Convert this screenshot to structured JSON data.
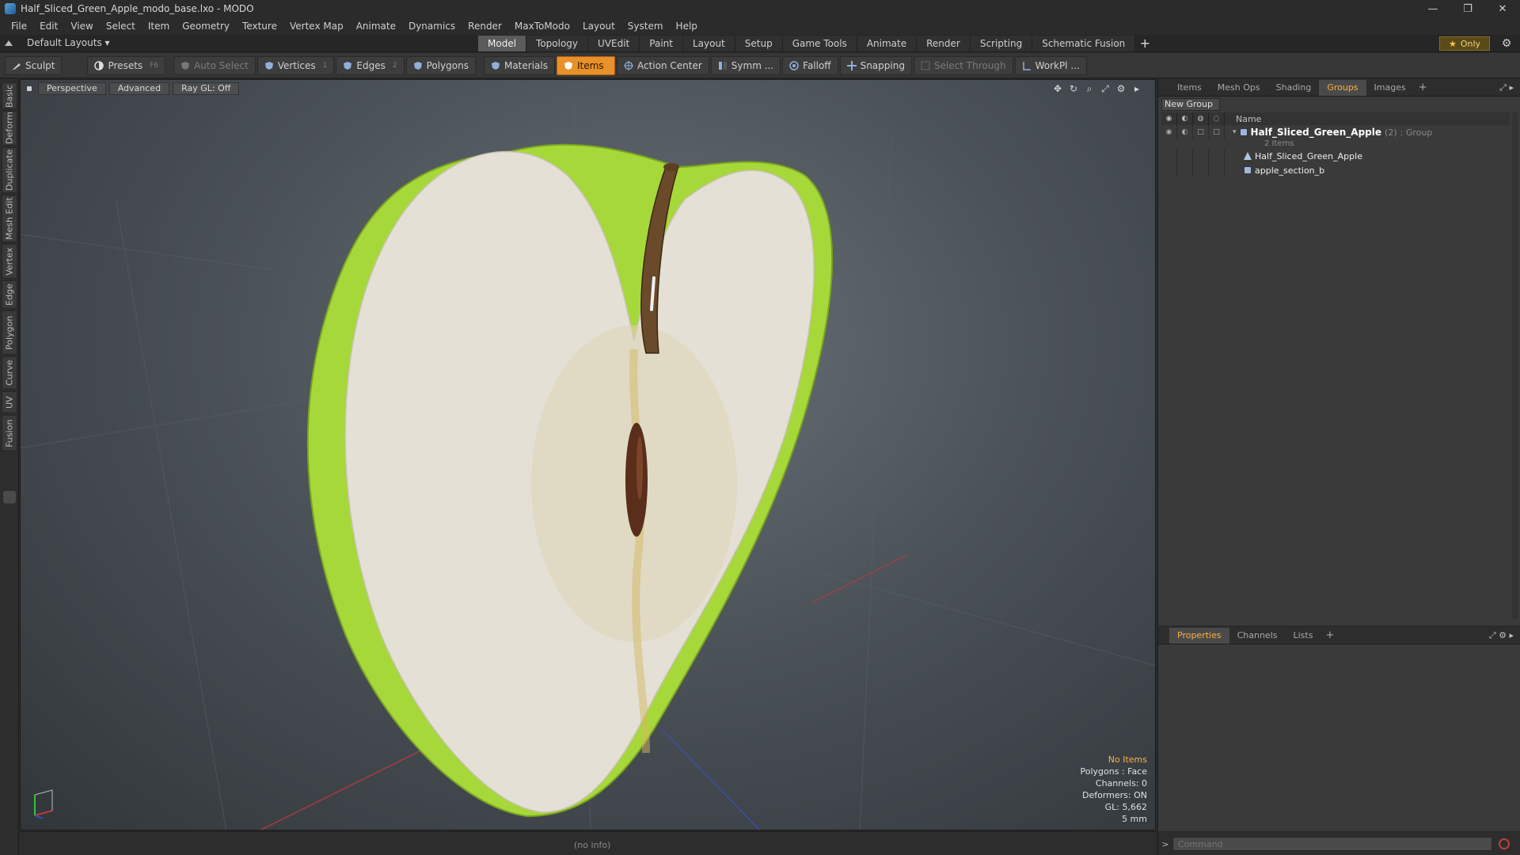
{
  "window": {
    "title": "Half_Sliced_Green_Apple_modo_base.lxo - MODO",
    "controls": [
      "—",
      "❐",
      "✕"
    ]
  },
  "menu": [
    "File",
    "Edit",
    "View",
    "Select",
    "Item",
    "Geometry",
    "Texture",
    "Vertex Map",
    "Animate",
    "Dynamics",
    "Render",
    "MaxToModo",
    "Layout",
    "System",
    "Help"
  ],
  "layoutbar": {
    "layouts_label": "Default Layouts ▾",
    "tabs": [
      "Model",
      "Topology",
      "UVEdit",
      "Paint",
      "Layout",
      "Setup",
      "Game Tools",
      "Animate",
      "Render",
      "Scripting",
      "Schematic Fusion"
    ],
    "active_tab": "Model",
    "add_tab": "+",
    "only_label": "Only"
  },
  "toolbar": {
    "sculpt": "Sculpt",
    "presets": "Presets",
    "presets_key": "F6",
    "auto_select": "Auto Select",
    "vertices": "Vertices",
    "vertices_key": "1",
    "edges": "Edges",
    "edges_key": "2",
    "polygons": "Polygons",
    "materials": "Materials",
    "items": "Items",
    "action_center": "Action Center",
    "symmetry": "Symm ...",
    "falloff": "Falloff",
    "snapping": "Snapping",
    "select_through": "Select Through",
    "workplane": "WorkPl ..."
  },
  "left_tabs": [
    "Basic",
    "Deform",
    "Duplicate",
    "Mesh Edit",
    "Vertex",
    "Edge",
    "Polygon",
    "Curve",
    "UV",
    "Fusion"
  ],
  "viewport": {
    "view": "Perspective",
    "mode": "Advanced",
    "raygl": "Ray GL: Off",
    "info": {
      "no_items": "No Items",
      "polygons": "Polygons : Face",
      "channels": "Channels: 0",
      "deformers": "Deformers: ON",
      "gl": "GL: 5,662",
      "units": "5 mm"
    }
  },
  "statusbar": {
    "info": "(no info)"
  },
  "top_panel": {
    "tabs": [
      "Items",
      "Mesh Ops",
      "Shading",
      "Groups",
      "Images"
    ],
    "active_tab": "Groups",
    "add": "+",
    "new_group": "New Group",
    "name_header": "Name",
    "group": {
      "name": "Half_Sliced_Green_Apple",
      "count": "(2)",
      "type": ": Group",
      "items_label": "2 Items"
    },
    "children": [
      "Half_Sliced_Green_Apple",
      "apple_section_b"
    ]
  },
  "bottom_panel": {
    "tabs": [
      "Properties",
      "Channels",
      "Lists"
    ],
    "active_tab": "Properties",
    "add": "+"
  },
  "command": {
    "placeholder": "Command",
    "chevron": ">"
  },
  "colors": {
    "accent": "#e8902a",
    "apple_skin": "#a6d83a",
    "apple_flesh": "#e4e0d6",
    "info_highlight": "#ffb040"
  }
}
